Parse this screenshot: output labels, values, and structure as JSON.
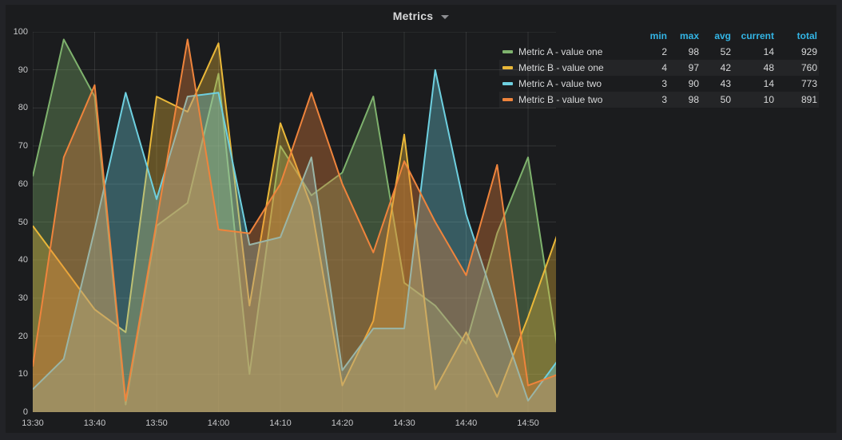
{
  "panel": {
    "title": "Metrics"
  },
  "y_axis": {
    "ticks": [
      100,
      90,
      80,
      70,
      60,
      50,
      40,
      30,
      20,
      10,
      0
    ]
  },
  "x_axis": {
    "ticks": [
      "13:30",
      "13:40",
      "13:50",
      "14:00",
      "14:10",
      "14:20",
      "14:30",
      "14:40",
      "14:50"
    ]
  },
  "legend": {
    "header_color": "#33b5e5",
    "headers": {
      "min": "min",
      "max": "max",
      "avg": "avg",
      "current": "current",
      "total": "total"
    },
    "series": [
      {
        "label": "Metric A - value one",
        "color": "#7eb26d",
        "min": 2,
        "max": 98,
        "avg": 52,
        "current": 14,
        "total": 929
      },
      {
        "label": "Metric B - value one",
        "color": "#eab839",
        "min": 4,
        "max": 97,
        "avg": 42,
        "current": 48,
        "total": 760
      },
      {
        "label": "Metric A - value two",
        "color": "#6ed0e0",
        "min": 3,
        "max": 90,
        "avg": 43,
        "current": 14,
        "total": 773
      },
      {
        "label": "Metric B - value two",
        "color": "#ef843c",
        "min": 3,
        "max": 98,
        "avg": 50,
        "current": 10,
        "total": 891
      }
    ]
  },
  "chart_data": {
    "type": "area",
    "title": "Metrics",
    "x": [
      "13:30",
      "13:35",
      "13:40",
      "13:45",
      "13:50",
      "13:55",
      "14:00",
      "14:05",
      "14:10",
      "14:15",
      "14:20",
      "14:25",
      "14:30",
      "14:35",
      "14:40",
      "14:45",
      "14:50",
      "14:55"
    ],
    "series": [
      {
        "name": "Metric A - value one",
        "color": "#7eb26d",
        "values": [
          62,
          98,
          83,
          2,
          49,
          55,
          89,
          10,
          70,
          57,
          63,
          83,
          34,
          28,
          18,
          47,
          67,
          14
        ]
      },
      {
        "name": "Metric B - value one",
        "color": "#eab839",
        "values": [
          49,
          38,
          27,
          21,
          83,
          79,
          97,
          28,
          76,
          54,
          7,
          24,
          73,
          6,
          21,
          4,
          25,
          48
        ]
      },
      {
        "name": "Metric A - value two",
        "color": "#6ed0e0",
        "values": [
          6,
          14,
          48,
          84,
          56,
          83,
          84,
          44,
          46,
          67,
          11,
          22,
          22,
          90,
          52,
          27,
          3,
          14
        ]
      },
      {
        "name": "Metric B - value two",
        "color": "#ef843c",
        "values": [
          12,
          67,
          86,
          3,
          50,
          98,
          48,
          47,
          60,
          84,
          60,
          42,
          66,
          50,
          36,
          65,
          7,
          10
        ]
      }
    ],
    "ylim": [
      0,
      100
    ],
    "y_tick_step": 10,
    "grid": true,
    "fill_opacity": 0.35,
    "line_width": 2,
    "legend_position": "top-right-table"
  }
}
